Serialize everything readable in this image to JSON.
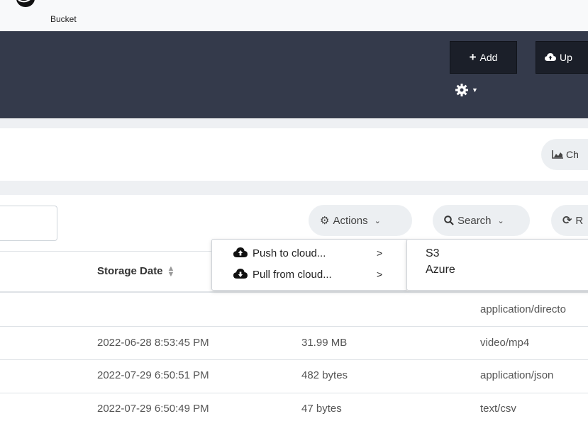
{
  "brand": {
    "name": "Bucket"
  },
  "header": {
    "add_label": "Add",
    "upload_label": "Up",
    "icons": {
      "add": "plus-icon",
      "upload": "cloud-upload-icon",
      "settings": "gear-icon"
    }
  },
  "chart_button": {
    "label": "Ch",
    "icon": "area-chart-icon"
  },
  "toolbar": {
    "actions_label": "Actions",
    "search_label": "Search",
    "refresh_label": "R",
    "filter_value": ""
  },
  "table": {
    "columns": {
      "storage_date": "Storage Date"
    },
    "rows": [
      {
        "date": "",
        "size": "",
        "type": "application/directo"
      },
      {
        "date": "2022-06-28 8:53:45 PM",
        "size": "31.99 MB",
        "type": "video/mp4"
      },
      {
        "date": "2022-07-29 6:50:51 PM",
        "size": "482 bytes",
        "type": "application/json"
      },
      {
        "date": "2022-07-29 6:50:49 PM",
        "size": "47 bytes",
        "type": "text/csv"
      }
    ]
  },
  "actions_menu": {
    "items": [
      {
        "label": "Push to cloud...",
        "chevron": ">"
      },
      {
        "label": "Pull from cloud...",
        "chevron": ">"
      }
    ]
  },
  "cloud_submenu": {
    "items": [
      {
        "label": "S3"
      },
      {
        "label": "Azure"
      }
    ]
  },
  "colors": {
    "header_bg": "#343a4b",
    "button_dark": "#1b1f29",
    "pill_bg": "#eceff2"
  }
}
